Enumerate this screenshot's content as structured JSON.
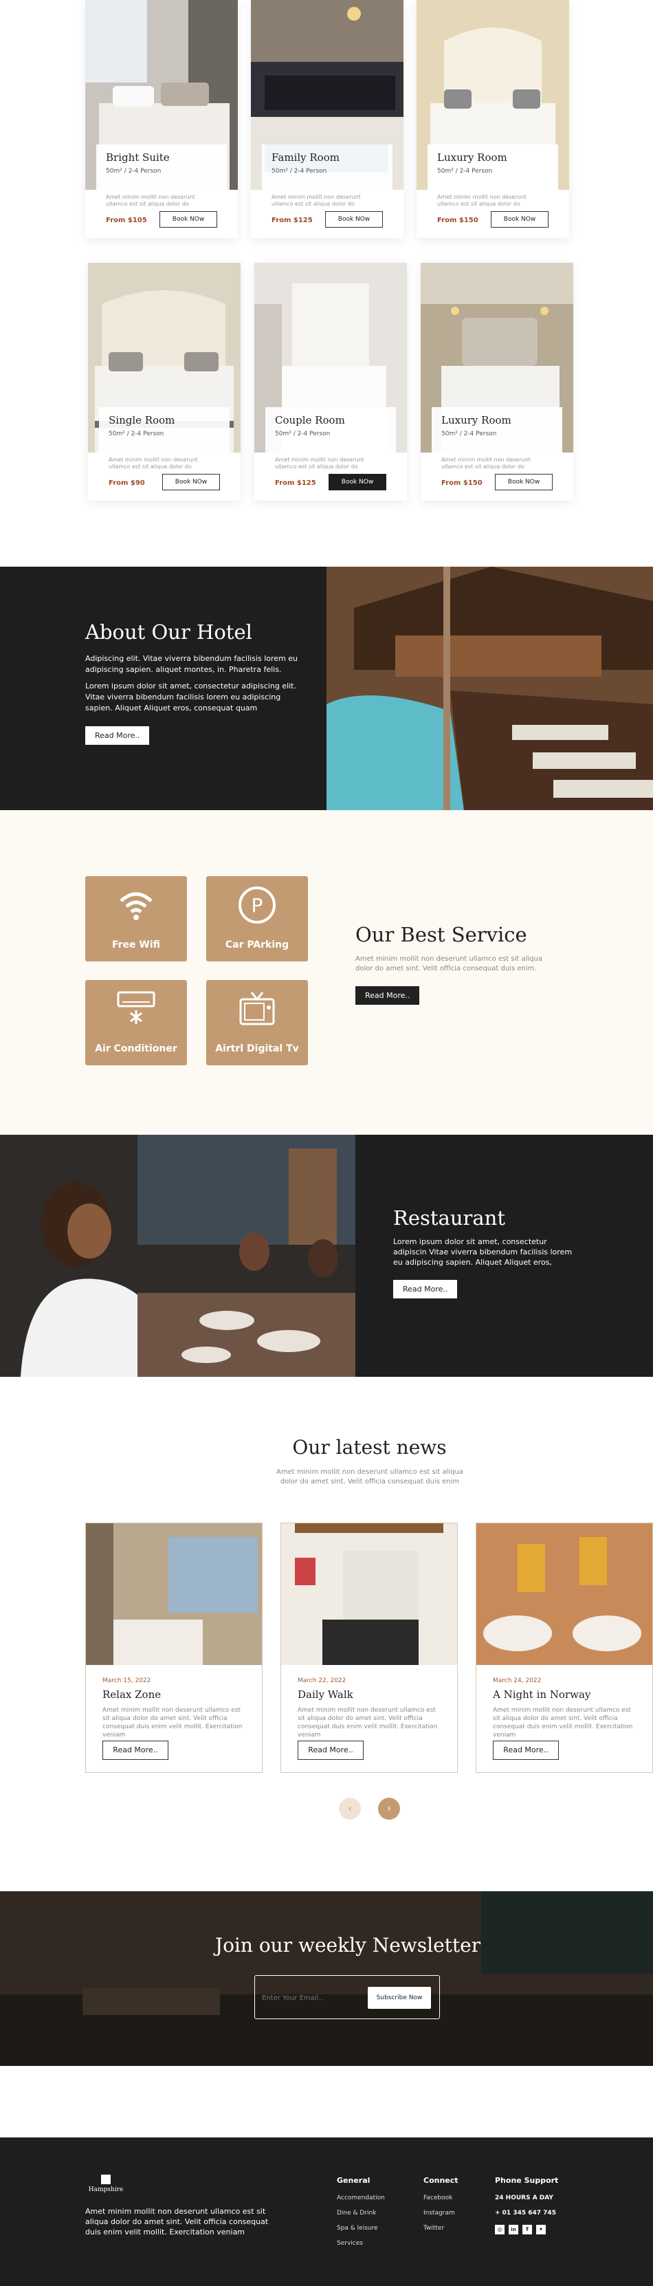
{
  "rooms": [
    {
      "name": "Bright Suite",
      "meta": "50m² / 2-4 Person",
      "desc": "Amet minim mollit non deserunt ullamco est sit aliqua dolor do",
      "price": "From $105",
      "btn": "Book NOw"
    },
    {
      "name": "Family Room",
      "meta": "50m² / 2-4 Person",
      "desc": "Amet minim mollit non deserunt ullamco est sit aliqua dolor do",
      "price": "From $125",
      "btn": "Book NOw"
    },
    {
      "name": "Luxury Room",
      "meta": "50m² / 2-4 Person",
      "desc": "Amet minim mollit non deserunt ullamco est sit aliqua dolor do",
      "price": "From $150",
      "btn": "Book NOw"
    },
    {
      "name": "Single Room",
      "meta": "50m² / 2-4 Person",
      "desc": "Amet minim mollit non deserunt ullamco est sit aliqua dolor do",
      "price": "From $90",
      "btn": "Book NOw"
    },
    {
      "name": "Couple Room",
      "meta": "50m² / 2-4 Person",
      "desc": "Amet minim mollit non deserunt ullamco est sit aliqua dolor do",
      "price": "From $125",
      "btn": "Book NOw"
    },
    {
      "name": "Luxury Room",
      "meta": "50m² / 2-4 Person",
      "desc": "Amet minim mollit non deserunt ullamco est sit aliqua dolor do",
      "price": "From $150",
      "btn": "Book NOw"
    }
  ],
  "about": {
    "title": "About Our Hotel",
    "p1": "Adipiscing elit. Vitae viverra bibendum facilisis lorem eu adipiscing sapien. aliquet montes, in. Pharetra felis.",
    "p2": "Lorem ipsum dolor sit amet, consectetur adipiscing elit. Vitae viverra bibendum facilisis lorem eu adipiscing sapien. Aliquet Aliquet eros, consequat quam",
    "btn": "Read More.."
  },
  "service": {
    "title": "Our Best Service",
    "desc": "Amet minim mollit non deserunt ullamco est sit aliqua dolor do amet sint. Velit officia consequat duis enim.",
    "btn": "Read More..",
    "items": [
      "Free Wifi",
      "Car PArking",
      "Air Conditioner",
      "Airtrl Digital Tv"
    ]
  },
  "restaurant": {
    "title": "Restaurant",
    "desc": "Lorem ipsum dolor sit amet, consectetur adipiscin Vitae viverra bibendum facilisis lorem eu adipiscing sapien. Aliquet Aliquet eros,",
    "btn": "Read More.."
  },
  "news": {
    "title": "Our latest news",
    "sub": "Amet minim mollit non deserunt ullamco est sit aliqua dolor do amet sint. Velit officia consequat duis enim",
    "items": [
      {
        "date": "March 15, 2022",
        "title": "Relax Zone",
        "desc": "Amet minim mollit non deserunt ullamco est sit aliqua dolor do amet sint. Velit officia consequat duis enim velit mollit. Exercitation veniam",
        "btn": "Read More.."
      },
      {
        "date": "March 22, 2022",
        "title": "Daily Walk",
        "desc": "Amet minim mollit non deserunt ullamco est sit aliqua dolor do amet sint. Velit officia consequat duis enim velit mollit. Exercitation veniam",
        "btn": "Read More.."
      },
      {
        "date": "March 24, 2022",
        "title": "A Night in Norway",
        "desc": "Amet minim mollit non deserunt ullamco est sit aliqua dolor do amet sint. Velit officia consequat duis enim velit mollit. Exercitation veniam",
        "btn": "Read More.."
      }
    ]
  },
  "newsletter": {
    "title": "Join our weekly Newsletter",
    "placeholder": "Enter Your Email..",
    "btn": "Subscribe Now"
  },
  "footer": {
    "logo": "Hampshire",
    "desc": "Amet minim mollit non deserunt ullamco est sit aliqua dolor do amet sint. Velit officia consequat duis enim velit mollit. Exercitation veniam",
    "general": {
      "title": "General",
      "links": [
        "Accomendation",
        "Dine & Drink",
        "Spa & leisure",
        "Services"
      ]
    },
    "connect": {
      "title": "Connect",
      "links": [
        "Facebook",
        "Instagram",
        "Twitter"
      ]
    },
    "support": {
      "title": "Phone Support",
      "hours": "24 HOURS A DAY",
      "phone": "+ 01 345 647 745"
    }
  },
  "colors": {
    "accent": "#c29b72",
    "dark": "#1e1e1e",
    "cream": "#fdf9f3",
    "price": "#a04a2a"
  }
}
